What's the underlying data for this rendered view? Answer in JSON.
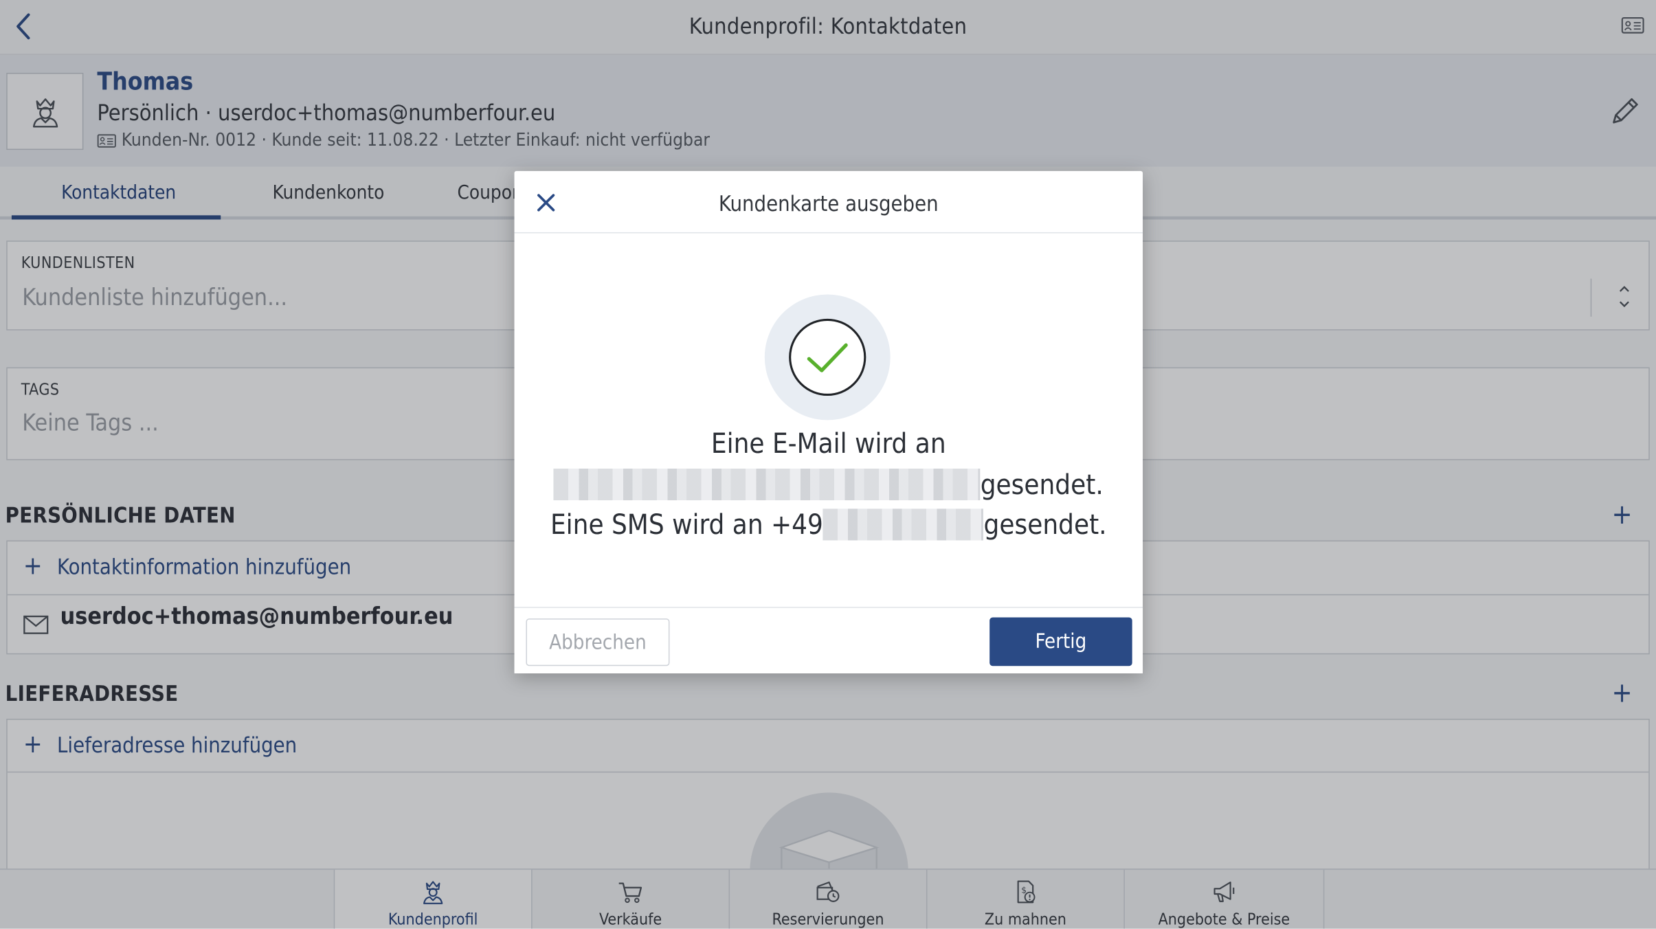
{
  "topbar": {
    "title": "Kundenprofil: Kontaktdaten",
    "back_icon": "chevron-left-icon",
    "card_icon": "customer-card-icon"
  },
  "customer": {
    "name": "Thomas",
    "line": "Persönlich · userdoc+thomas@numberfour.eu",
    "meta": "Kunden-Nr. 0012 · Kunde seit: 11.08.22 · Letzter Einkauf: nicht verfügbar"
  },
  "tabs": [
    {
      "label": "Kontaktdaten",
      "active": true
    },
    {
      "label": "Kundenkonto",
      "active": false
    },
    {
      "label": "Coupon",
      "active": false
    }
  ],
  "customer_lists": {
    "label": "KUNDENLISTEN",
    "placeholder": "Kundenliste hinzufügen..."
  },
  "tags": {
    "label": "TAGS",
    "placeholder": "Keine Tags ..."
  },
  "personal_data": {
    "title": "PERSÖNLICHE DATEN",
    "add_contact_label": "Kontaktinformation hinzufügen",
    "email": "userdoc+thomas@numberfour.eu"
  },
  "delivery_address": {
    "title": "LIEFERADRESSE",
    "add_label": "Lieferadresse hinzufügen"
  },
  "bottom_nav": [
    {
      "label": "Kundenprofil",
      "icon": "customer-profile-icon",
      "active": true
    },
    {
      "label": "Verkäufe",
      "icon": "shopping-cart-icon",
      "active": false
    },
    {
      "label": "Reservierungen",
      "icon": "reservation-icon",
      "active": false
    },
    {
      "label": "Zu mahnen",
      "icon": "dunning-icon",
      "active": false
    },
    {
      "label": "Angebote & Preise",
      "icon": "megaphone-icon",
      "active": false
    }
  ],
  "modal": {
    "title": "Kundenkarte ausgeben",
    "message_line1": "Eine E-Mail wird an",
    "message_line2_suffix": "gesendet.",
    "message_line3_prefix": "Eine SMS wird an +49",
    "message_line3_suffix": "gesendet.",
    "cancel_label": "Abbrechen",
    "done_label": "Fertig",
    "success_icon": "check-circle-icon"
  },
  "colors": {
    "accent": "#2a4a85",
    "success": "#58b02c"
  }
}
